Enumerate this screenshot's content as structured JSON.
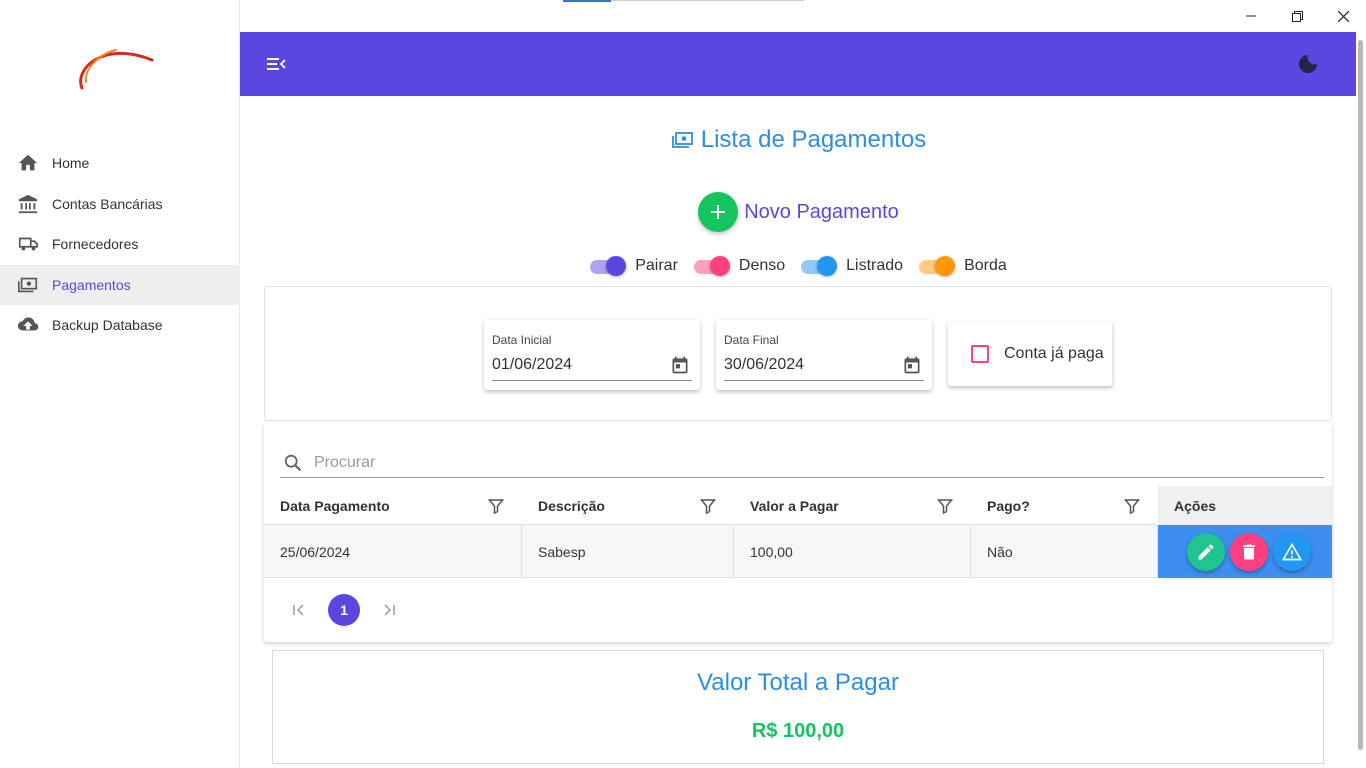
{
  "window": {
    "minimize_icon": "minimize-icon",
    "maximize_icon": "restore-icon",
    "close_icon": "close-icon"
  },
  "sidebar": {
    "items": [
      {
        "label": "Home",
        "icon": "home-icon",
        "active": false
      },
      {
        "label": "Contas Bancárias",
        "icon": "bank-icon",
        "active": false
      },
      {
        "label": "Fornecedores",
        "icon": "truck-icon",
        "active": false
      },
      {
        "label": "Pagamentos",
        "icon": "payments-icon",
        "active": true
      },
      {
        "label": "Backup Database",
        "icon": "cloud-upload-icon",
        "active": false
      }
    ]
  },
  "appbar": {
    "menu_icon": "menu-collapse-icon",
    "theme_icon": "dark-mode-icon",
    "color": "#5b47e0"
  },
  "page": {
    "title": "Lista de Pagamentos",
    "new_button": "Novo Pagamento"
  },
  "toggles": [
    {
      "label": "Pairar",
      "color": "#5b47e0",
      "on": true
    },
    {
      "label": "Denso",
      "color": "#ff3f80",
      "on": true
    },
    {
      "label": "Listrado",
      "color": "#2196f3",
      "on": true
    },
    {
      "label": "Borda",
      "color": "#ff9800",
      "on": true
    }
  ],
  "filters": {
    "start_label": "Data Inicial",
    "start_value": "01/06/2024",
    "end_label": "Data Final",
    "end_value": "30/06/2024",
    "paid_label": "Conta já paga",
    "paid_checked": false
  },
  "table": {
    "search_placeholder": "Procurar",
    "columns": [
      "Data Pagamento",
      "Descrição",
      "Valor a Pagar",
      "Pago?",
      "Ações"
    ],
    "rows": [
      [
        "25/06/2024",
        "Sabesp",
        "100,00",
        "Não"
      ]
    ],
    "actions": [
      "edit-icon",
      "delete-icon",
      "warning-icon"
    ],
    "page": "1"
  },
  "total": {
    "title": "Valor Total a Pagar",
    "value": "R$ 100,00"
  }
}
